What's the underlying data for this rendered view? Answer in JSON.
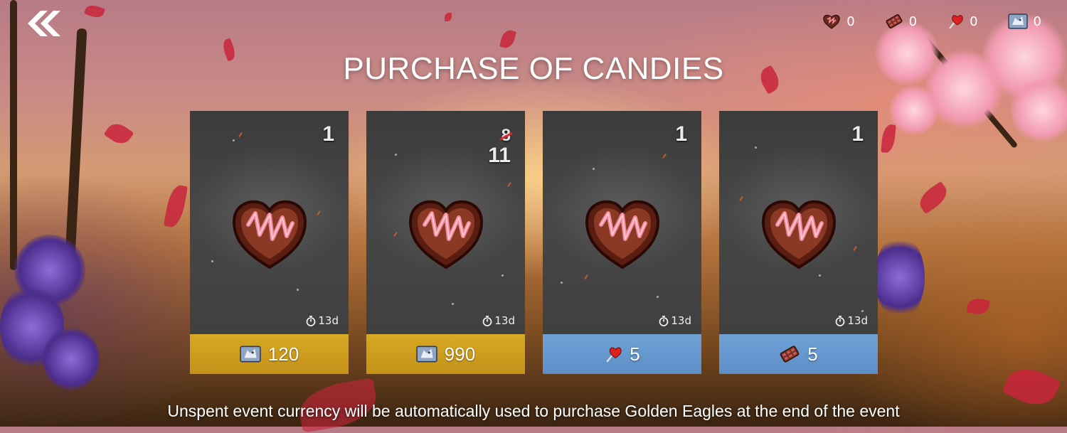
{
  "header": {
    "title": "PURCHASE OF CANDIES",
    "back_icon": "double-chevron-left-icon"
  },
  "currencies": [
    {
      "name": "chocolate-candy-icon",
      "count": "0"
    },
    {
      "name": "chocolate-bar-icon",
      "count": "0"
    },
    {
      "name": "lollipop-icon",
      "count": "0"
    },
    {
      "name": "golden-eagle-icon",
      "count": "0"
    }
  ],
  "offers": [
    {
      "qty": "1",
      "timer": "13d",
      "price": "120",
      "currency_icon": "golden-eagle-icon",
      "button_color": "#c99a1d"
    },
    {
      "qty_old": "8",
      "qty": "11",
      "timer": "13d",
      "price": "990",
      "currency_icon": "golden-eagle-icon",
      "button_color": "#c99a1d"
    },
    {
      "qty": "1",
      "timer": "13d",
      "price": "5",
      "currency_icon": "lollipop-icon",
      "button_color": "#6496cc"
    },
    {
      "qty": "1",
      "timer": "13d",
      "price": "5",
      "currency_icon": "chocolate-bar-icon",
      "button_color": "#6496cc"
    }
  ],
  "footer": {
    "note": "Unspent event currency will be automatically used to purchase Golden Eagles at the end of the event"
  }
}
